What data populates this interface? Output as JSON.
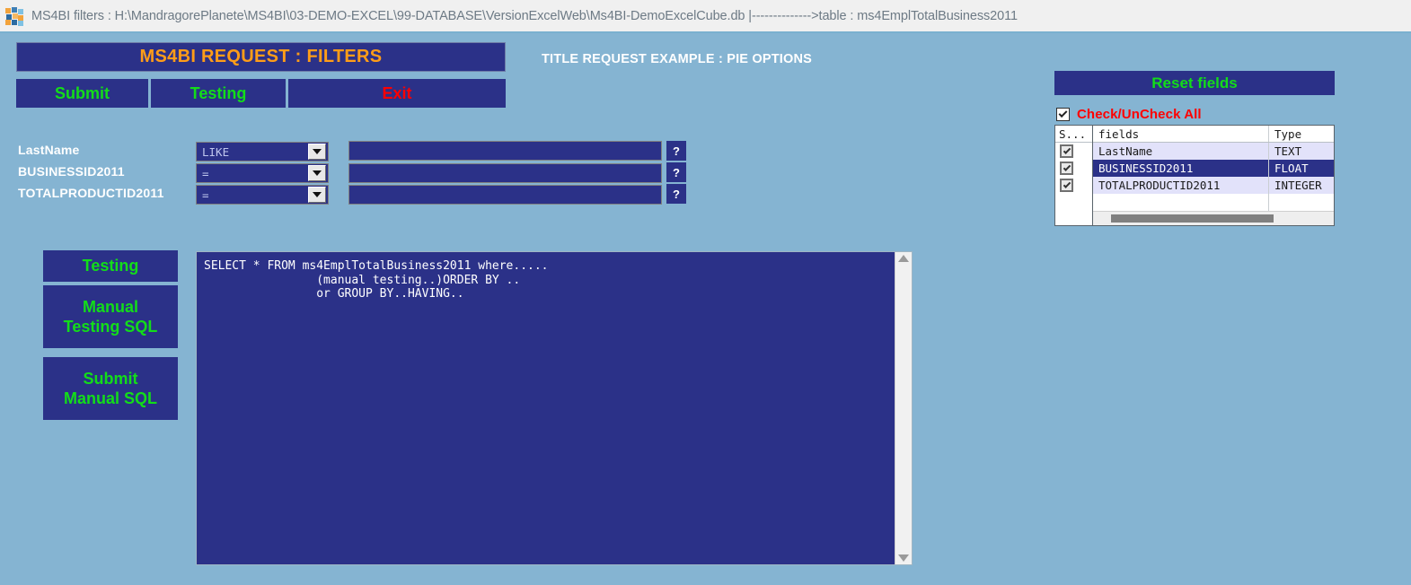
{
  "titlebar": {
    "icon": "app-mosaic-icon",
    "text": "MS4BI filters  : H:\\MandragorePlanete\\MS4BI\\03-DEMO-EXCEL\\99-DATABASE\\VersionExcelWeb\\Ms4BI-DemoExcelCube.db  |-------------->table : ms4EmplTotalBusiness2011"
  },
  "header": {
    "banner": "MS4BI REQUEST : FILTERS",
    "request_title": "TITLE REQUEST EXAMPLE : PIE OPTIONS",
    "buttons": {
      "submit": "Submit",
      "testing": "Testing",
      "exit": "Exit"
    }
  },
  "filters": {
    "help_label": "?",
    "rows": [
      {
        "label": "LastName",
        "operator": "LIKE",
        "value": "",
        "placeholder": ""
      },
      {
        "label": "BUSINESSID2011",
        "operator": "=",
        "value": "",
        "placeholder": ""
      },
      {
        "label": "TOTALPRODUCTID2011",
        "operator": "=",
        "value": "",
        "placeholder": ""
      }
    ]
  },
  "side_buttons": [
    {
      "line1": "Testing",
      "line2": ""
    },
    {
      "line1": "Manual",
      "line2": "Testing SQL"
    },
    {
      "line1": "Submit",
      "line2": "Manual SQL"
    }
  ],
  "sql_editor": {
    "text": "SELECT * FROM ms4EmplTotalBusiness2011 where.....\n                (manual testing..)ORDER BY ..\n                or GROUP BY..HAVING.."
  },
  "right_panel": {
    "reset_label": "Reset fields",
    "check_all_label": "Check/UnCheck All",
    "check_all_checked": true,
    "grid": {
      "headers": {
        "select": "S...",
        "field": "fields",
        "type": "Type"
      },
      "rows": [
        {
          "checked": true,
          "field": "LastName",
          "type": "TEXT",
          "selected": false
        },
        {
          "checked": true,
          "field": "BUSINESSID2011",
          "type": "FLOAT",
          "selected": true
        },
        {
          "checked": true,
          "field": "TOTALPRODUCTID2011",
          "type": "INTEGER",
          "selected": false
        }
      ]
    }
  },
  "colors": {
    "page_background": "#85b4d2",
    "panel_blue": "#2b3188",
    "accent_orange": "#ff9d18",
    "accent_green": "#13dd19",
    "accent_red": "#ff0000",
    "grid_row": "#e2e2fa",
    "titlebar_bg": "#f0f0f0"
  }
}
